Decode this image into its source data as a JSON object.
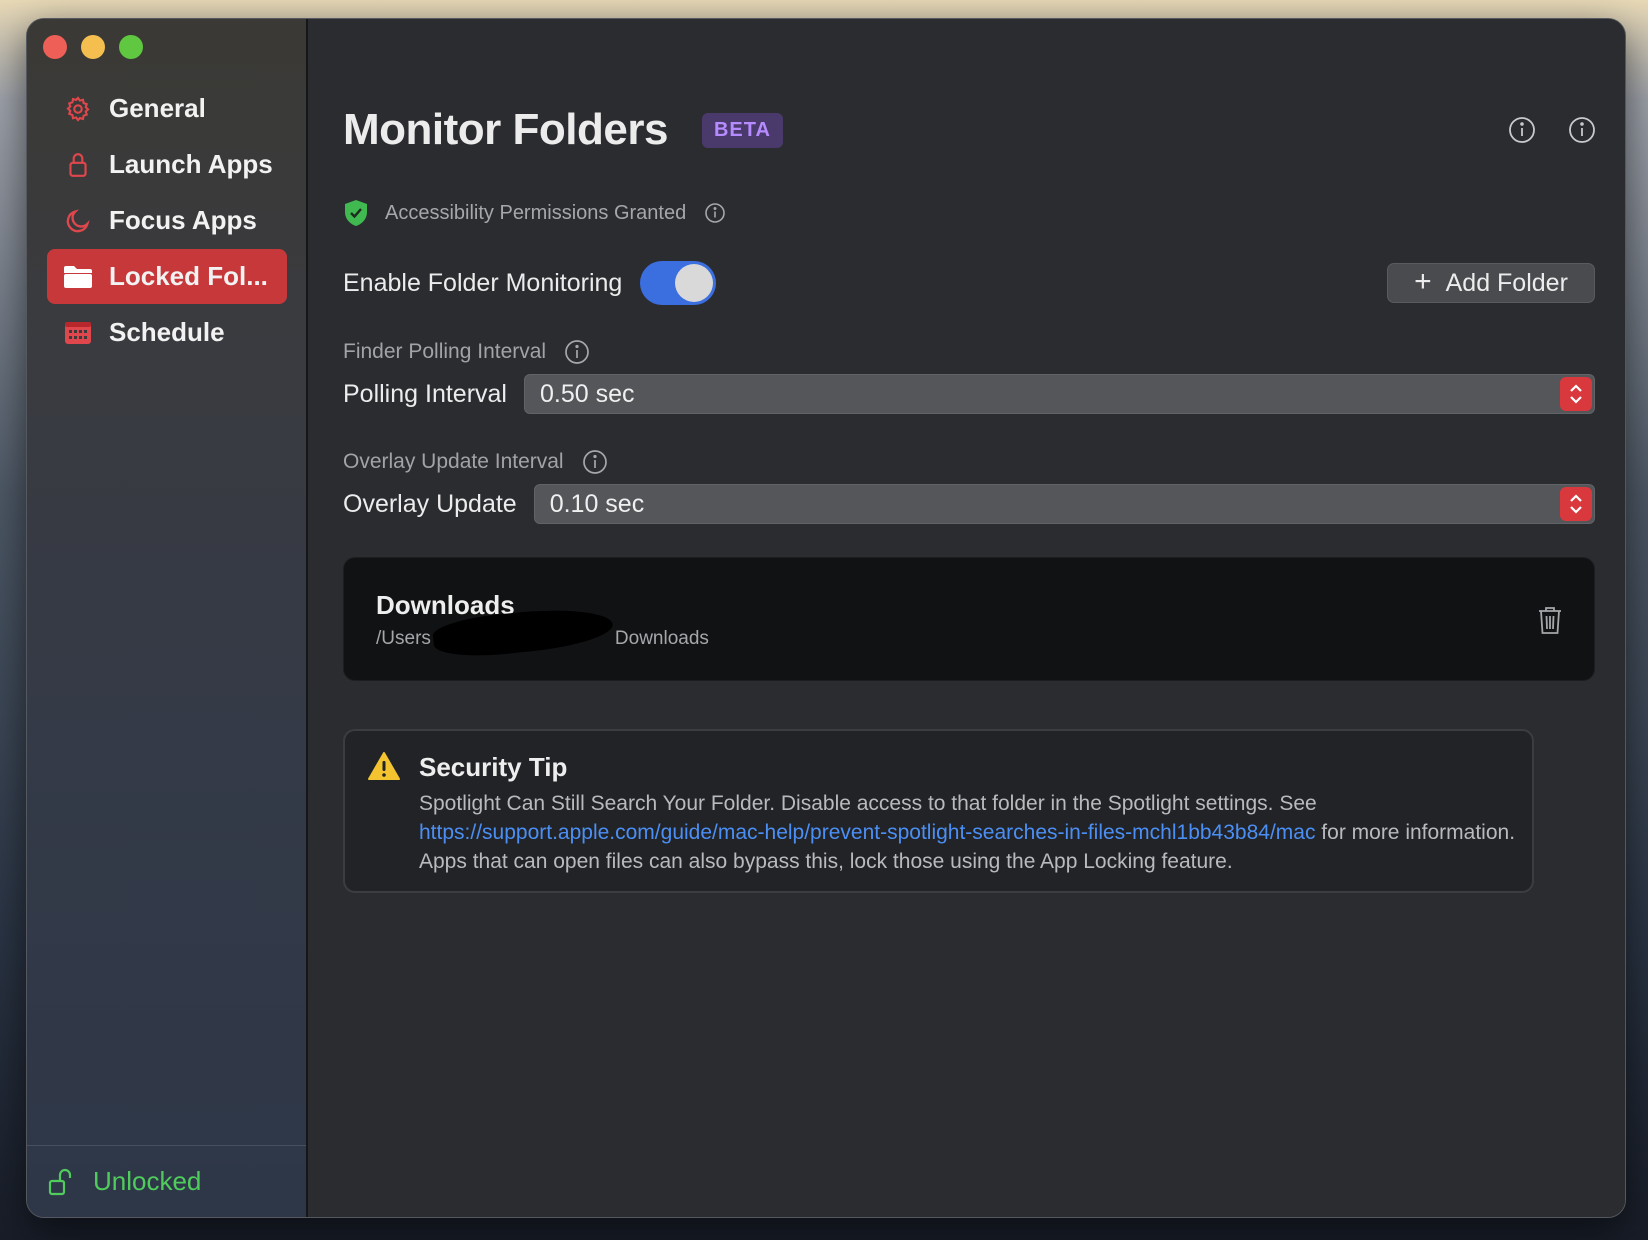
{
  "sidebar": {
    "items": [
      {
        "label": "General",
        "icon": "gear-icon",
        "active": false
      },
      {
        "label": "Launch Apps",
        "icon": "lock-icon",
        "active": false
      },
      {
        "label": "Focus Apps",
        "icon": "moon-icon",
        "active": false
      },
      {
        "label": "Locked Fol...",
        "icon": "folder-icon",
        "active": true
      },
      {
        "label": "Schedule",
        "icon": "calendar-icon",
        "active": false
      }
    ],
    "footer": {
      "label": "Unlocked",
      "icon": "unlock-icon"
    }
  },
  "header": {
    "title": "Monitor Folders",
    "badge": "BETA"
  },
  "permissions": {
    "text": "Accessibility Permissions Granted"
  },
  "monitoring": {
    "label": "Enable Folder Monitoring",
    "enabled": true
  },
  "add_folder": {
    "label": "Add Folder"
  },
  "polling": {
    "section_label": "Finder Polling Interval",
    "field_label": "Polling Interval",
    "value": "0.50 sec"
  },
  "overlay": {
    "section_label": "Overlay Update Interval",
    "field_label": "Overlay Update",
    "value": "0.10 sec"
  },
  "folders": [
    {
      "name": "Downloads",
      "path_prefix": "/Users",
      "path_suffix": "Downloads"
    }
  ],
  "security_tip": {
    "title": "Security Tip",
    "text_before": "Spotlight Can Still Search Your Folder. Disable access to that folder in the Spotlight settings. See ",
    "link": "https://support.apple.com/guide/mac-help/prevent-spotlight-searches-in-files-mchl1bb43b84/mac",
    "text_after": " for more information. Apps that can open files can also bypass this, lock those using the App Locking feature."
  },
  "colors": {
    "accent_red": "#c7383b",
    "toggle_blue": "#3b6fe0",
    "unlocked_green": "#4fcc5c",
    "beta_purple": "#b58bff",
    "link_blue": "#4b8ff5"
  }
}
